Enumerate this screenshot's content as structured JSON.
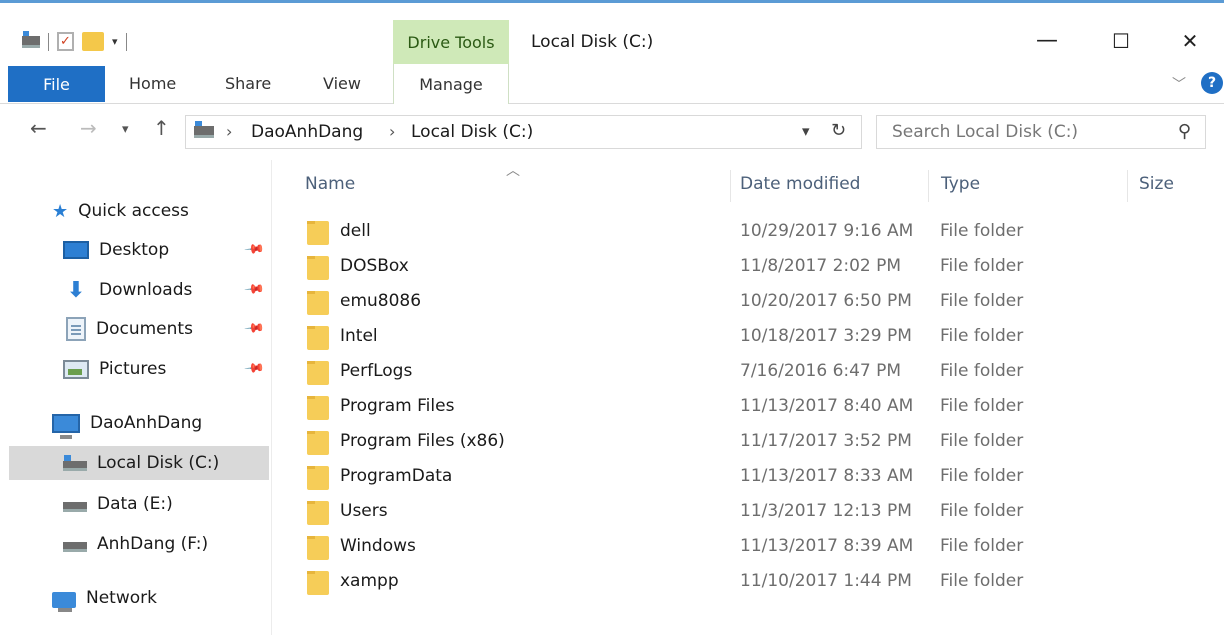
{
  "window": {
    "title": "Local Disk (C:)",
    "context_tab": "Drive Tools",
    "minimize": "—",
    "maximize": "☐",
    "close": "✕"
  },
  "ribbon": {
    "tabs": [
      "File",
      "Home",
      "Share",
      "View",
      "Manage"
    ],
    "help": "?"
  },
  "address": {
    "crumbs": [
      "DaoAnhDang",
      "Local Disk (C:)"
    ],
    "search_placeholder": "Search Local Disk (C:)"
  },
  "sidebar": {
    "quick_access": "Quick access",
    "pinned": [
      {
        "label": "Desktop",
        "icon": "desktop-icon"
      },
      {
        "label": "Downloads",
        "icon": "downloads-icon"
      },
      {
        "label": "Documents",
        "icon": "documents-icon"
      },
      {
        "label": "Pictures",
        "icon": "pictures-icon"
      }
    ],
    "this_pc": "DaoAnhDang",
    "drives": [
      {
        "label": "Local Disk (C:)",
        "selected": true
      },
      {
        "label": "Data (E:)",
        "selected": false
      },
      {
        "label": "AnhDang (F:)",
        "selected": false
      }
    ],
    "network": "Network"
  },
  "list": {
    "columns": {
      "name": "Name",
      "date": "Date modified",
      "type": "Type",
      "size": "Size"
    },
    "rows": [
      {
        "name": "dell",
        "date": "10/29/2017 9:16 AM",
        "type": "File folder"
      },
      {
        "name": "DOSBox",
        "date": "11/8/2017 2:02 PM",
        "type": "File folder"
      },
      {
        "name": "emu8086",
        "date": "10/20/2017 6:50 PM",
        "type": "File folder"
      },
      {
        "name": "Intel",
        "date": "10/18/2017 3:29 PM",
        "type": "File folder"
      },
      {
        "name": "PerfLogs",
        "date": "7/16/2016 6:47 PM",
        "type": "File folder"
      },
      {
        "name": "Program Files",
        "date": "11/13/2017 8:40 AM",
        "type": "File folder"
      },
      {
        "name": "Program Files (x86)",
        "date": "11/17/2017 3:52 PM",
        "type": "File folder"
      },
      {
        "name": "ProgramData",
        "date": "11/13/2017 8:33 AM",
        "type": "File folder"
      },
      {
        "name": "Users",
        "date": "11/3/2017 12:13 PM",
        "type": "File folder"
      },
      {
        "name": "Windows",
        "date": "11/13/2017 8:39 AM",
        "type": "File folder"
      },
      {
        "name": "xampp",
        "date": "11/10/2017 1:44 PM",
        "type": "File folder"
      }
    ]
  },
  "colors": {
    "accent": "#1f6fc5",
    "drive_tools": "#cfe9b8",
    "selected": "#d9d9d9"
  }
}
